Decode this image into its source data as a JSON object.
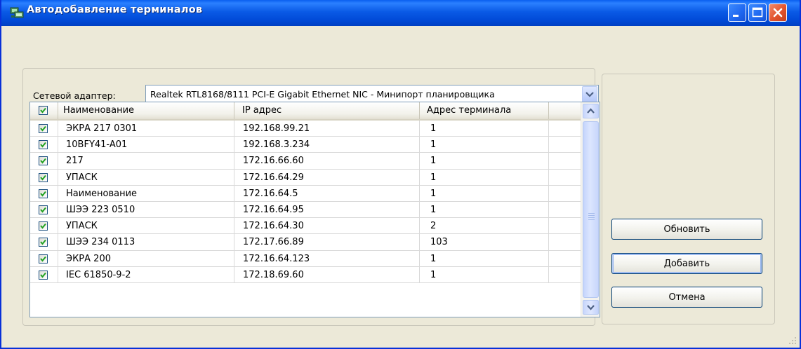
{
  "window": {
    "title": "Автодобавление терминалов",
    "icon": "network-terminal-icon",
    "controls": [
      "minimize-icon",
      "maximize-icon",
      "close-icon"
    ]
  },
  "adapter": {
    "label": "Сетевой адаптер:",
    "selected": "Realtek RTL8168/8111 PCI-E Gigabit Ethernet NIC - Минипорт планировщика"
  },
  "table": {
    "headers": [
      "Наименование",
      "IP адрес",
      "Адрес терминала"
    ],
    "rows": [
      {
        "checked": true,
        "name": "ЭКРА 217 0301",
        "ip": "192.168.99.21",
        "addr": "1"
      },
      {
        "checked": true,
        "name": "10BFY41-A01",
        "ip": "192.168.3.234",
        "addr": "1"
      },
      {
        "checked": true,
        "name": "217",
        "ip": "172.16.66.60",
        "addr": "1"
      },
      {
        "checked": true,
        "name": "УПАСК",
        "ip": "172.16.64.29",
        "addr": "1"
      },
      {
        "checked": true,
        "name": "Наименование",
        "ip": "172.16.64.5",
        "addr": "1"
      },
      {
        "checked": true,
        "name": "ШЭЭ 223 0510",
        "ip": "172.16.64.95",
        "addr": "1"
      },
      {
        "checked": true,
        "name": "УПАСК",
        "ip": "172.16.64.30",
        "addr": "2"
      },
      {
        "checked": true,
        "name": "ШЭЭ 234 0113",
        "ip": "172.17.66.89",
        "addr": "103"
      },
      {
        "checked": true,
        "name": "ЭКРА 200",
        "ip": "172.16.64.123",
        "addr": "1"
      },
      {
        "checked": true,
        "name": "IEC 61850-9-2",
        "ip": "172.18.69.60",
        "addr": "1"
      }
    ]
  },
  "buttons": {
    "refresh": "Обновить",
    "add": "Добавить",
    "cancel": "Отмена"
  },
  "colors": {
    "titlebar": "#0A5AE6",
    "face": "#ECE9D8",
    "border": "#7F9DB9",
    "check": "#21A121"
  }
}
